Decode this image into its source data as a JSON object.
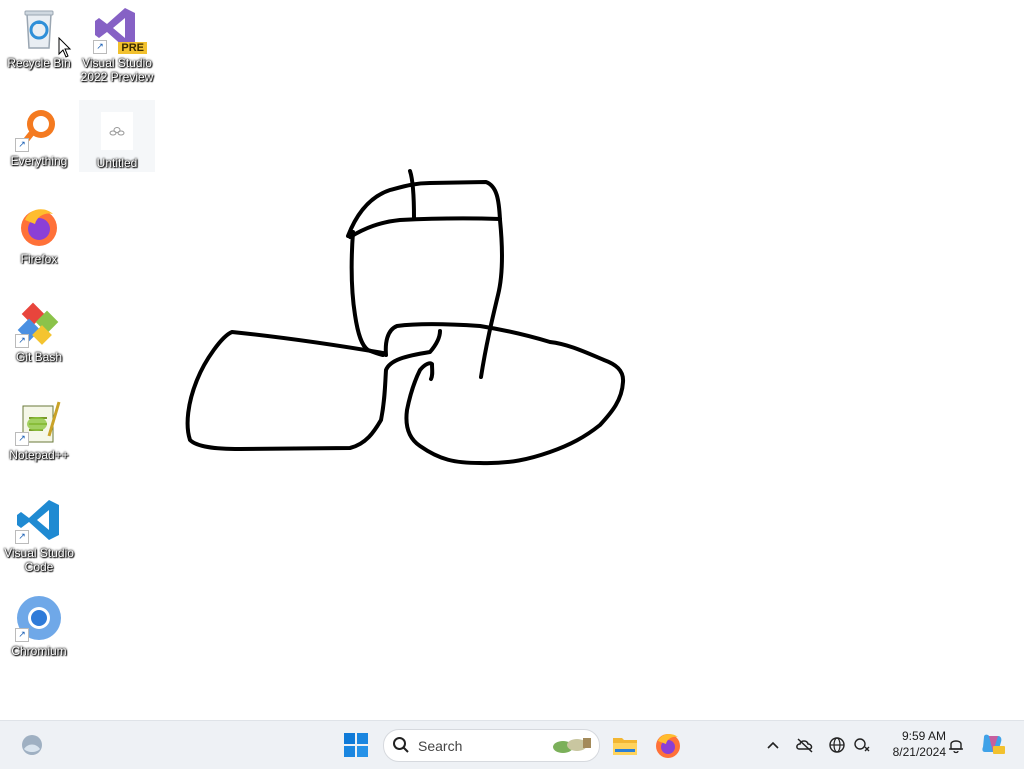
{
  "desktop": {
    "icons": [
      {
        "id": "recycle-bin",
        "label": "Recycle Bin",
        "icon": "recycle-bin-icon"
      },
      {
        "id": "visual-studio-2022-preview",
        "label": "Visual Studio\n2022 Preview",
        "icon": "visual-studio-preview-icon",
        "badge": "PRE"
      },
      {
        "id": "everything",
        "label": "Everything",
        "icon": "everything-search-icon"
      },
      {
        "id": "untitled",
        "label": "Untitled",
        "icon": "untitled-file-icon"
      },
      {
        "id": "firefox",
        "label": "Firefox",
        "icon": "firefox-icon"
      },
      {
        "id": "git-bash",
        "label": "Git Bash",
        "icon": "git-bash-icon"
      },
      {
        "id": "notepad-plus-plus",
        "label": "Notepad++",
        "icon": "notepad-plus-plus-icon"
      },
      {
        "id": "visual-studio-code",
        "label": "Visual Studio\nCode",
        "icon": "vscode-icon"
      },
      {
        "id": "chromium",
        "label": "Chromium",
        "icon": "chromium-icon"
      }
    ],
    "drawing": "freehand-black-ink-sketch"
  },
  "taskbar": {
    "search": {
      "label": "Search"
    },
    "pinned": [
      "start-icon",
      "search-icon",
      "file-explorer-icon",
      "firefox-icon"
    ],
    "tray": [
      "chevron-up-icon",
      "onedrive-offline-icon",
      "network-globe-icon",
      "settings-sync-icon",
      "notification-bell-icon",
      "copilot-preview-icon"
    ],
    "clock": {
      "time": "9:59 AM",
      "date": "8/21/2024"
    }
  },
  "colors": {
    "accent": "#0078d4",
    "taskbar_bg": "#eef1f5",
    "ink": "#000000"
  }
}
